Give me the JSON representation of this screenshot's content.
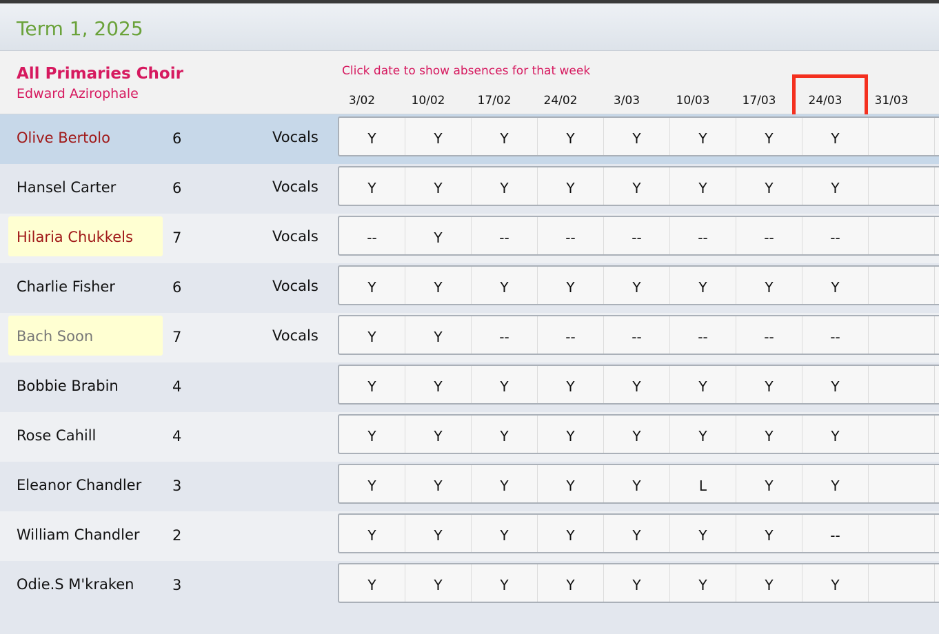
{
  "term": {
    "title": "Term 1, 2025"
  },
  "group": {
    "name": "All Primaries Choir",
    "teacher": "Edward Azirophale",
    "hint": "Click date to show absences for that week"
  },
  "dates": [
    "3/02",
    "10/02",
    "17/02",
    "24/02",
    "3/03",
    "10/03",
    "17/03",
    "24/03",
    "31/03"
  ],
  "highlighted_date_index": 7,
  "students": [
    {
      "name": "Olive Bertolo",
      "year": "6",
      "instrument": "Vocals",
      "style": "red",
      "selected": true,
      "flagged": false,
      "attendance": [
        "Y",
        "Y",
        "Y",
        "Y",
        "Y",
        "Y",
        "Y",
        "Y",
        ""
      ]
    },
    {
      "name": "Hansel Carter",
      "year": "6",
      "instrument": "Vocals",
      "style": "normal",
      "selected": false,
      "flagged": false,
      "attendance": [
        "Y",
        "Y",
        "Y",
        "Y",
        "Y",
        "Y",
        "Y",
        "Y",
        ""
      ]
    },
    {
      "name": "Hilaria Chukkels",
      "year": "7",
      "instrument": "Vocals",
      "style": "red",
      "selected": false,
      "flagged": true,
      "attendance": [
        "--",
        "Y",
        "--",
        "--",
        "--",
        "--",
        "--",
        "--",
        ""
      ]
    },
    {
      "name": "Charlie Fisher",
      "year": "6",
      "instrument": "Vocals",
      "style": "normal",
      "selected": false,
      "flagged": false,
      "attendance": [
        "Y",
        "Y",
        "Y",
        "Y",
        "Y",
        "Y",
        "Y",
        "Y",
        ""
      ]
    },
    {
      "name": "Bach Soon",
      "year": "7",
      "instrument": "Vocals",
      "style": "grey",
      "selected": false,
      "flagged": true,
      "attendance": [
        "Y",
        "Y",
        "--",
        "--",
        "--",
        "--",
        "--",
        "--",
        ""
      ]
    },
    {
      "name": "Bobbie Brabin",
      "year": "4",
      "instrument": "",
      "style": "normal",
      "selected": false,
      "flagged": false,
      "attendance": [
        "Y",
        "Y",
        "Y",
        "Y",
        "Y",
        "Y",
        "Y",
        "Y",
        ""
      ]
    },
    {
      "name": "Rose Cahill",
      "year": "4",
      "instrument": "",
      "style": "normal",
      "selected": false,
      "flagged": false,
      "attendance": [
        "Y",
        "Y",
        "Y",
        "Y",
        "Y",
        "Y",
        "Y",
        "Y",
        ""
      ]
    },
    {
      "name": "Eleanor Chandler",
      "year": "3",
      "instrument": "",
      "style": "normal",
      "selected": false,
      "flagged": false,
      "attendance": [
        "Y",
        "Y",
        "Y",
        "Y",
        "Y",
        "L",
        "Y",
        "Y",
        ""
      ]
    },
    {
      "name": "William Chandler",
      "year": "2",
      "instrument": "",
      "style": "normal",
      "selected": false,
      "flagged": false,
      "attendance": [
        "Y",
        "Y",
        "Y",
        "Y",
        "Y",
        "Y",
        "Y",
        "--",
        ""
      ]
    },
    {
      "name": "Odie.S M'kraken",
      "year": "3",
      "instrument": "",
      "style": "normal",
      "selected": false,
      "flagged": false,
      "attendance": [
        "Y",
        "Y",
        "Y",
        "Y",
        "Y",
        "Y",
        "Y",
        "Y",
        ""
      ]
    }
  ],
  "colors": {
    "term_title": "#6aa23a",
    "group_accent": "#d6195f",
    "name_red": "#a01818",
    "flag_background": "#ffffd2",
    "selected_row": "#c7d8e9",
    "highlight_border": "#f4301f"
  }
}
